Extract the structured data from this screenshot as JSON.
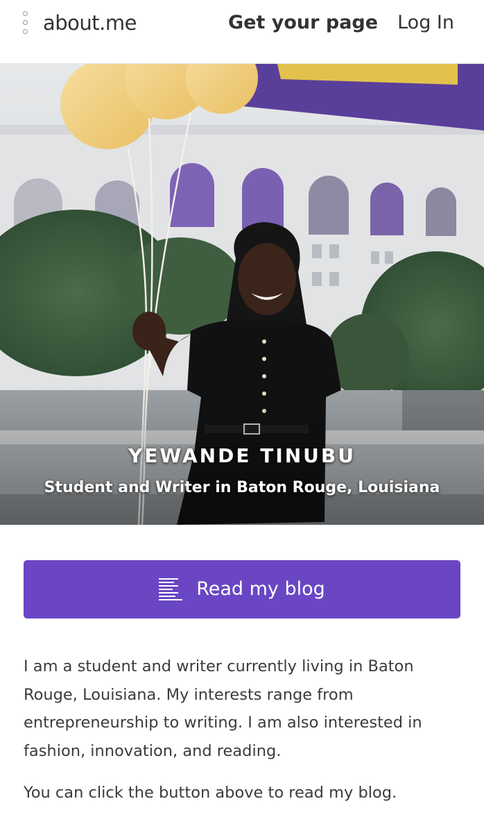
{
  "header": {
    "brand": "about.me",
    "cta_label": "Get your page",
    "login_label": "Log In",
    "menu_icon": "vertical-dots-icon"
  },
  "hero": {
    "name": "YEWANDE TINUBU",
    "headline": "Student and Writer in Baton Rouge, Louisiana",
    "photo_description_icon": "profile-photo"
  },
  "actions": {
    "blog_label": "Read my blog",
    "blog_icon": "lines-icon"
  },
  "bio": {
    "paragraphs": [
      "I am a student and writer currently living in Baton Rouge, Louisiana. My interests range from entrepreneurship to writing. I am also interested in fashion, innovation, and reading.",
      "You can click the button above to read my blog."
    ]
  },
  "colors": {
    "accent": "#6a46c4",
    "text": "#3b3b3b",
    "header_text": "#333333",
    "background": "#ffffff"
  }
}
